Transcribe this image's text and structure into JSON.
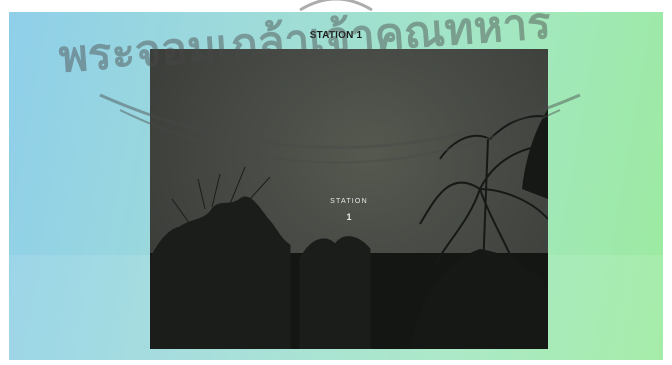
{
  "station": {
    "title": "STATION 1",
    "overlay_word": "STATION",
    "overlay_number": "1"
  },
  "watermark": {
    "text": "พระจอมเกล้าเจ้าคุณทหาร",
    "color": "#4a4a4a"
  },
  "colors": {
    "gradient_left": "#8fcfe9",
    "gradient_right": "#9cea9f",
    "camera_bg": "#3b3e3b"
  }
}
